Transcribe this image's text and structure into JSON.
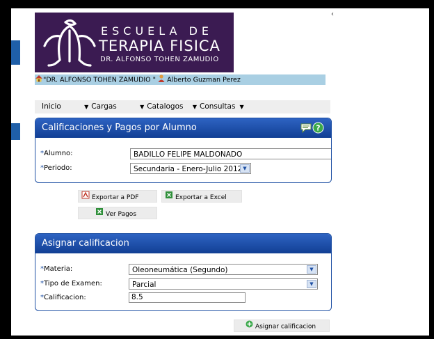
{
  "stray_char": "‹",
  "logo": {
    "line1": "ESCUELA DE",
    "line2": "TERAPIA FISICA",
    "line3": "DR. ALFONSO TOHEN ZAMUDIO"
  },
  "userbar": {
    "school": "\"DR. ALFONSO TOHEN ZAMUDIO \"",
    "user": "Alberto Guzman Perez"
  },
  "nav": [
    {
      "label": "Inicio",
      "has_arrow": false
    },
    {
      "label": "Cargas",
      "has_arrow": true
    },
    {
      "label": "Catalogos",
      "has_arrow": true
    },
    {
      "label": "Consultas",
      "has_arrow": true
    }
  ],
  "panel1": {
    "title": "Calificaciones y Pagos por Alumno",
    "alumno_label": "Alumno:",
    "alumno_value": "BADILLO FELIPE MALDONADO",
    "periodo_label": "Periodo:",
    "periodo_value": "Secundaria - Enero-Julio 2012"
  },
  "buttons": {
    "pdf": "Exportar a PDF",
    "excel": "Exportar a Excel",
    "pagos": "Ver Pagos",
    "asignar": "Asignar calificacion"
  },
  "panel2": {
    "title": "Asignar calificacion",
    "materia_label": "Materia:",
    "materia_value": "Oleoneumática (Segundo)",
    "tipo_label": "Tipo de Examen:",
    "tipo_value": "Parcial",
    "calif_label": "Calificacion:",
    "calif_value": "8.5"
  },
  "colors": {
    "panel_header": "#1d4fa3",
    "logo_bg": "#3b1b52",
    "userbar_bg": "#a9cfe3"
  }
}
